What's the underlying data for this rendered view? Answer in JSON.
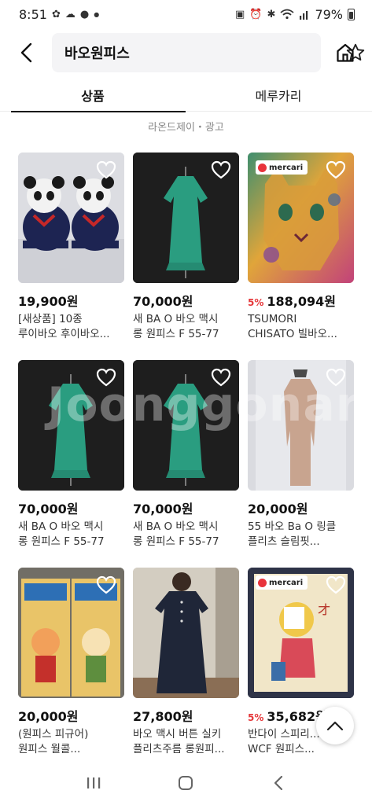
{
  "status_bar": {
    "time": "8:51",
    "battery": "79%",
    "icons": [
      "fan-icon",
      "cloud-icon",
      "chat-icon",
      "dot-icon",
      "screen-record-icon",
      "alarm-icon",
      "bluetooth-icon",
      "wifi-icon",
      "signal-icon",
      "battery-icon"
    ]
  },
  "header": {
    "search_query": "바오원피스",
    "back_icon": "chevron-left-icon",
    "star_icon": "star-icon",
    "home_icon": "home-icon"
  },
  "tabs": [
    {
      "label": "상품",
      "active": true
    },
    {
      "label": "메루카리",
      "active": false
    }
  ],
  "ad_label": "라온드제이・광고",
  "watermark": "Joonggonara",
  "products": [
    {
      "price": "19,900원",
      "discount": "",
      "title_line1": "[새상품] 10종",
      "title_line2": "루이바오 후이바오...",
      "badge": ""
    },
    {
      "price": "70,000원",
      "discount": "",
      "title_line1": "새 BA O 바오 맥시",
      "title_line2": "롱 원피스 F 55-77",
      "badge": ""
    },
    {
      "price": "188,094원",
      "discount": "5%",
      "title_line1": "TSUMORI",
      "title_line2": "CHISATO 빌바오...",
      "badge": "mercari"
    },
    {
      "price": "70,000원",
      "discount": "",
      "title_line1": "새 BA O 바오 맥시",
      "title_line2": "롱 원피스 F 55-77",
      "badge": ""
    },
    {
      "price": "70,000원",
      "discount": "",
      "title_line1": "새 BA O 바오 맥시",
      "title_line2": "롱 원피스 F 55-77",
      "badge": ""
    },
    {
      "price": "20,000원",
      "discount": "",
      "title_line1": "55 바오 Ba O 링클",
      "title_line2": "플리츠 슬림핏...",
      "badge": ""
    },
    {
      "price": "20,000원",
      "discount": "",
      "title_line1": "(원피스 피규어)",
      "title_line2": "원피스 월콜...",
      "badge": ""
    },
    {
      "price": "27,800원",
      "discount": "",
      "title_line1": "바오 맥시 버튼 실키",
      "title_line2": "플리츠주름 롱원피...",
      "badge": ""
    },
    {
      "price": "35,682원",
      "discount": "5%",
      "title_line1": "반다이 스피리...",
      "title_line2": "WCF 원피스...",
      "badge": "mercari"
    }
  ],
  "colors": {
    "discount": "#e5383b",
    "mercari_red": "#e8333b",
    "tab_underline": "#111111"
  }
}
